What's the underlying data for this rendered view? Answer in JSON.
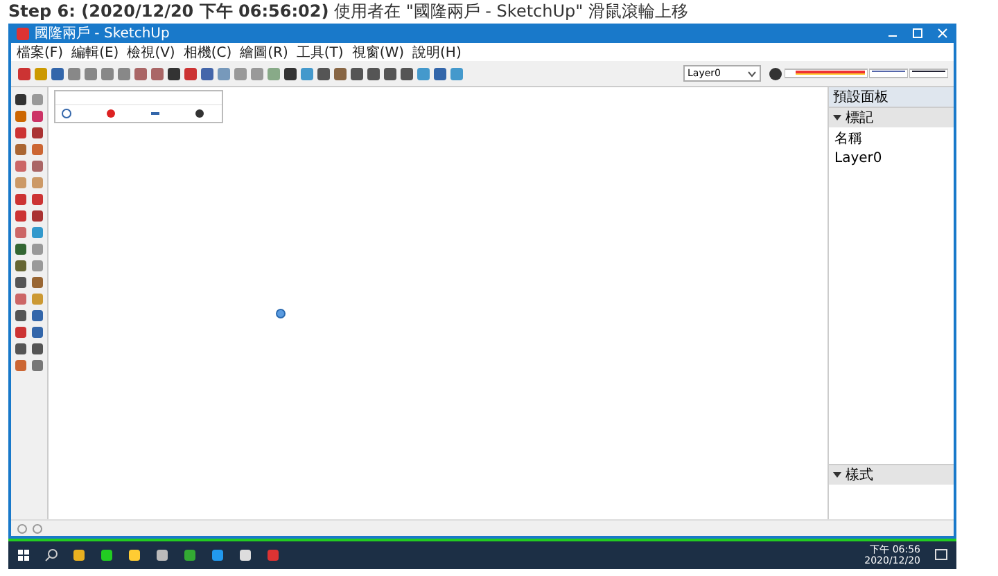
{
  "caption": {
    "text": "**Step 6: (2020/12/20 下午 06:56:02)** 使用者在 \"國隆兩戶 - SketchUp\" 滑鼠滾輪上移"
  },
  "window": {
    "title": "國隆兩戶 - SketchUp"
  },
  "menus": [
    "檔案(F)",
    "編輯(E)",
    "檢視(V)",
    "相機(C)",
    "繪圖(R)",
    "工具(T)",
    "視窗(W)",
    "說明(H)"
  ],
  "tag_dropdown": {
    "value": "Layer0"
  },
  "tray": {
    "title": "預設面板",
    "sections": [
      {
        "title": "標記",
        "expanded": true,
        "header": "名稱",
        "items": [
          "Layer0"
        ]
      },
      {
        "title": "樣式",
        "expanded": true
      }
    ]
  },
  "taskbar": {
    "time": "下午 06:56",
    "date": "2020/12/20"
  }
}
